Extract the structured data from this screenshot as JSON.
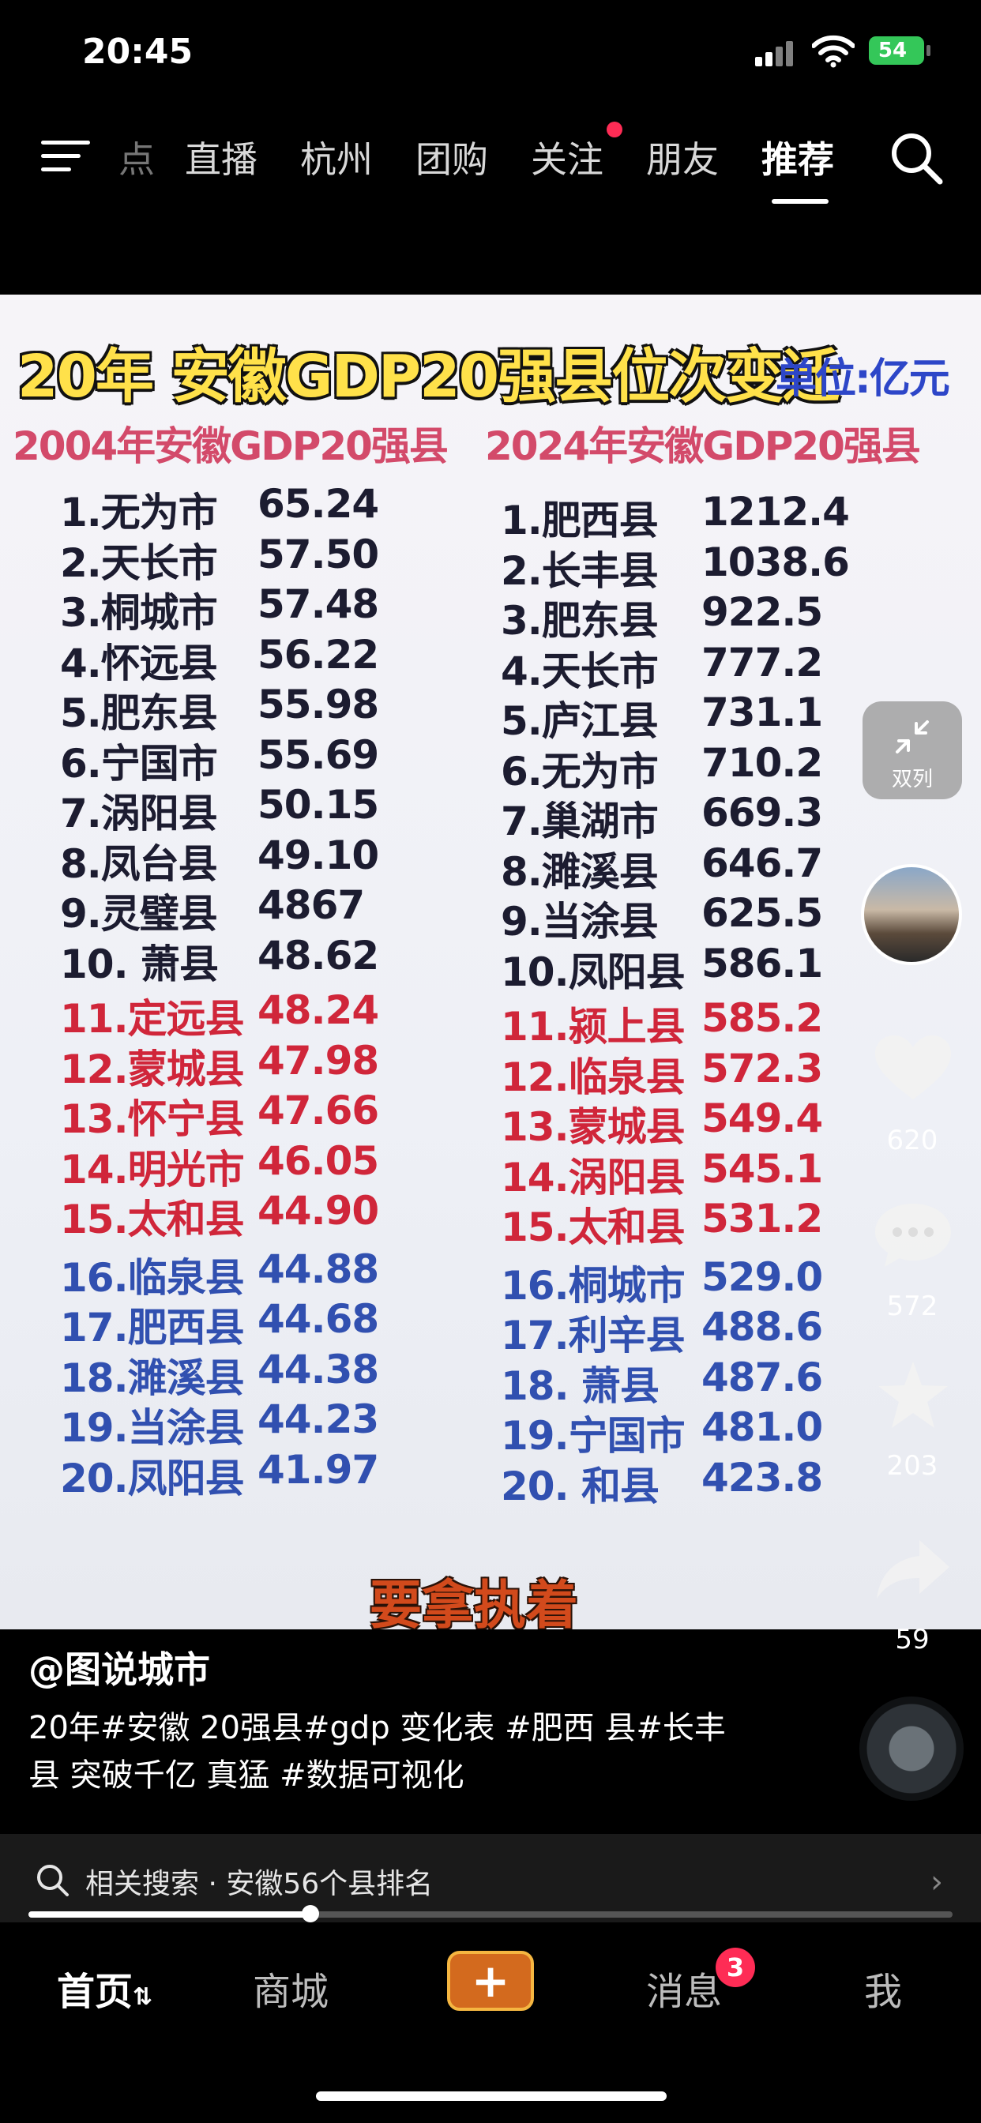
{
  "status_bar": {
    "time": "20:45",
    "battery": "54"
  },
  "top_nav": {
    "tabs": [
      "点",
      "直播",
      "杭州",
      "团购",
      "关注",
      "朋友",
      "推荐"
    ],
    "active_tab": "推荐"
  },
  "video": {
    "title": "20年 安徽GDP20强县位次变迁",
    "unit": "单位:亿元",
    "left_header": "2004年安徽GDP20强县",
    "right_header": "2024年安徽GDP20强县",
    "subtitle": "要拿执着",
    "left_list": [
      {
        "name": "1.无为市",
        "value": "65.24"
      },
      {
        "name": "2.天长市",
        "value": "57.50"
      },
      {
        "name": "3.桐城市",
        "value": "57.48"
      },
      {
        "name": "4.怀远县",
        "value": "56.22"
      },
      {
        "name": "5.肥东县",
        "value": "55.98"
      },
      {
        "name": "6.宁国市",
        "value": "55.69"
      },
      {
        "name": "7.涡阳县",
        "value": "50.15"
      },
      {
        "name": "8.凤台县",
        "value": "49.10"
      },
      {
        "name": "9.灵璧县",
        "value": "4867"
      },
      {
        "name": "10.  萧县",
        "value": "48.62"
      },
      {
        "name": "11.定远县",
        "value": "48.24"
      },
      {
        "name": "12.蒙城县",
        "value": "47.98"
      },
      {
        "name": "13.怀宁县",
        "value": "47.66"
      },
      {
        "name": "14.明光市",
        "value": "46.05"
      },
      {
        "name": "15.太和县",
        "value": "44.90"
      },
      {
        "name": "16.临泉县",
        "value": "44.88"
      },
      {
        "name": "17.肥西县",
        "value": "44.68"
      },
      {
        "name": "18.濉溪县",
        "value": "44.38"
      },
      {
        "name": "19.当涂县",
        "value": "44.23"
      },
      {
        "name": "20.凤阳县",
        "value": "41.97"
      }
    ],
    "right_list": [
      {
        "name": "1.肥西县",
        "value": "1212.4"
      },
      {
        "name": "2.长丰县",
        "value": "1038.6"
      },
      {
        "name": "3.肥东县",
        "value": "922.5"
      },
      {
        "name": "4.天长市",
        "value": "777.2"
      },
      {
        "name": "5.庐江县",
        "value": "731.1"
      },
      {
        "name": "6.无为市",
        "value": "710.2"
      },
      {
        "name": "7.巢湖市",
        "value": "669.3"
      },
      {
        "name": "8.濉溪县",
        "value": "646.7"
      },
      {
        "name": "9.当涂县",
        "value": "625.5"
      },
      {
        "name": "10.凤阳县",
        "value": "586.1"
      },
      {
        "name": "11.颍上县",
        "value": "585.2"
      },
      {
        "name": "12.临泉县",
        "value": "572.3"
      },
      {
        "name": "13.蒙城县",
        "value": "549.4"
      },
      {
        "name": "14.涡阳县",
        "value": "545.1"
      },
      {
        "name": "15.太和县",
        "value": "531.2"
      },
      {
        "name": "16.桐城市",
        "value": "529.0"
      },
      {
        "name": "17.利辛县",
        "value": "488.6"
      },
      {
        "name": "18.  萧县",
        "value": "487.6"
      },
      {
        "name": "19.宁国市",
        "value": "481.0"
      },
      {
        "name": "20.  和县",
        "value": "423.8"
      }
    ]
  },
  "side_rail": {
    "dual_label": "双列",
    "likes": "620",
    "comments": "572",
    "favorites": "203",
    "shares": "59"
  },
  "caption": {
    "author": "@图说城市",
    "text": "20年#安徽 20强县#gdp 变化表 #肥西 县#长丰县 突破千亿 真猛 #数据可视化"
  },
  "related_search": {
    "text": "相关搜索 · 安徽56个县排名"
  },
  "progress": {
    "played_fraction": 0.305
  },
  "bottom_tabs": {
    "home": "首页",
    "mall": "商城",
    "add": "+",
    "messages": "消息",
    "messages_badge": "3",
    "me": "我"
  },
  "colors": {
    "accent_red": "#fe2c55",
    "title_yellow": "#ffe14a",
    "rank_red": "#d0263a",
    "rank_blue": "#3150b0"
  }
}
